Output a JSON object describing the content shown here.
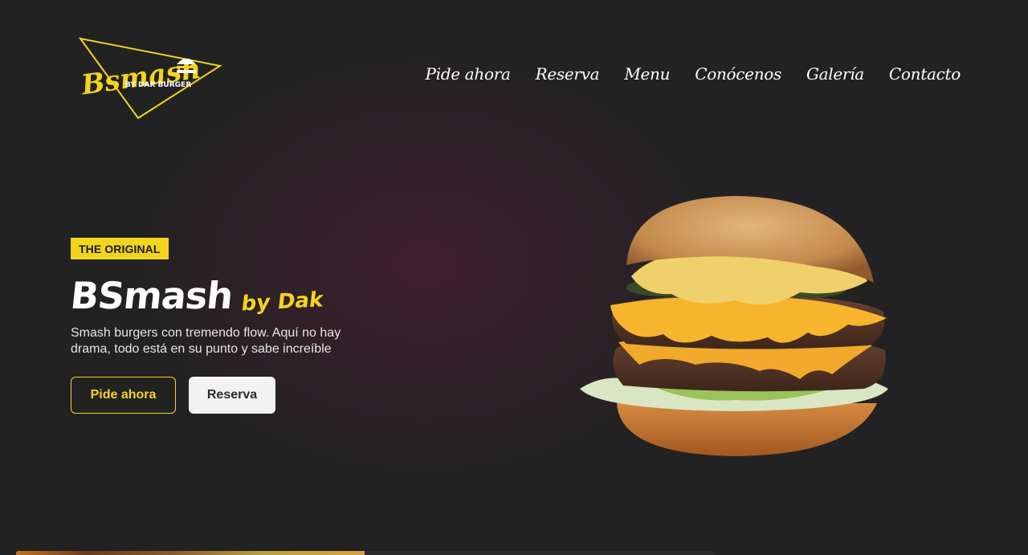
{
  "brand": {
    "logo_text": "Bsmash",
    "logo_subtext": "BY DAK BURGER",
    "accent_color": "#f2d41f",
    "background_color": "#222223"
  },
  "nav": {
    "items": [
      {
        "label": "Pide ahora"
      },
      {
        "label": "Reserva"
      },
      {
        "label": "Menu"
      },
      {
        "label": "Conócenos"
      },
      {
        "label": "Galería"
      },
      {
        "label": "Contacto"
      }
    ]
  },
  "hero": {
    "badge": "THE ORIGINAL",
    "title": "BSmash",
    "title_suffix": "by Dak",
    "description": "Smash burgers con tremendo flow. Aquí no hay drama, todo está en su punto y sabe increíble",
    "primary_button": "Pide ahora",
    "secondary_button": "Reserva",
    "image_icon": "burger-photo"
  }
}
